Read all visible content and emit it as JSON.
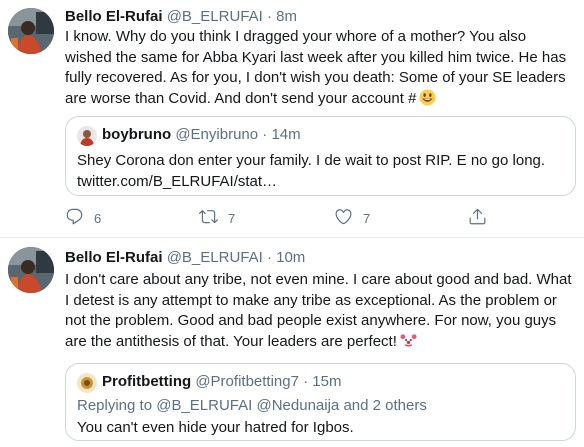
{
  "tweets": [
    {
      "author_name": "Bello El-Rufai",
      "author_handle": "@B_ELRUFAI",
      "separator": "·",
      "time": "8m",
      "text": "I know. Why do you think I dragged your whore of a mother? You also wished the same for Abba Kyari last week after you killed him twice. He has fully recovered. As for you, I don't wish you death: Some of your SE leaders are worse than Covid. And don't send your account #",
      "text_emoji": "grinning-face-emoji",
      "quote": {
        "author_name": "boybruno",
        "author_handle": "@Enyibruno",
        "separator": "·",
        "time": "14m",
        "text_line1": "Shey Corona don enter your family. I de wait to post RIP. E no go long.",
        "text_line2": "twitter.com/B_ELRUFAI/stat…"
      },
      "actions": {
        "reply_count": "6",
        "retweet_count": "7",
        "like_count": "7"
      }
    },
    {
      "author_name": "Bello El-Rufai",
      "author_handle": "@B_ELRUFAI",
      "separator": "·",
      "time": "10m",
      "text": "I don't care about any tribe, not even mine. I care about good and bad. What I detest is any attempt to make any tribe as exceptional. As the problem or not the problem. Good and bad people exist anywhere. For now, you guys are the antithesis of that. Your leaders are perfect!",
      "text_emoji": "clown-face-emoji",
      "quote": {
        "author_name": "Profitbetting",
        "author_handle": "@Profitbetting7",
        "separator": "·",
        "time": "15m",
        "replying_prefix": "Replying to",
        "replying_to": "@B_ELRUFAI @Nedunaija",
        "replying_suffix": "and 2 others",
        "text": "You can't even hide your hatred for Igbos."
      }
    }
  ],
  "colors": {
    "text": "#14171a",
    "secondary": "#5b7083",
    "link": "#1b95e0",
    "border": "#ccd6dd",
    "divider": "#e6ecf0"
  }
}
